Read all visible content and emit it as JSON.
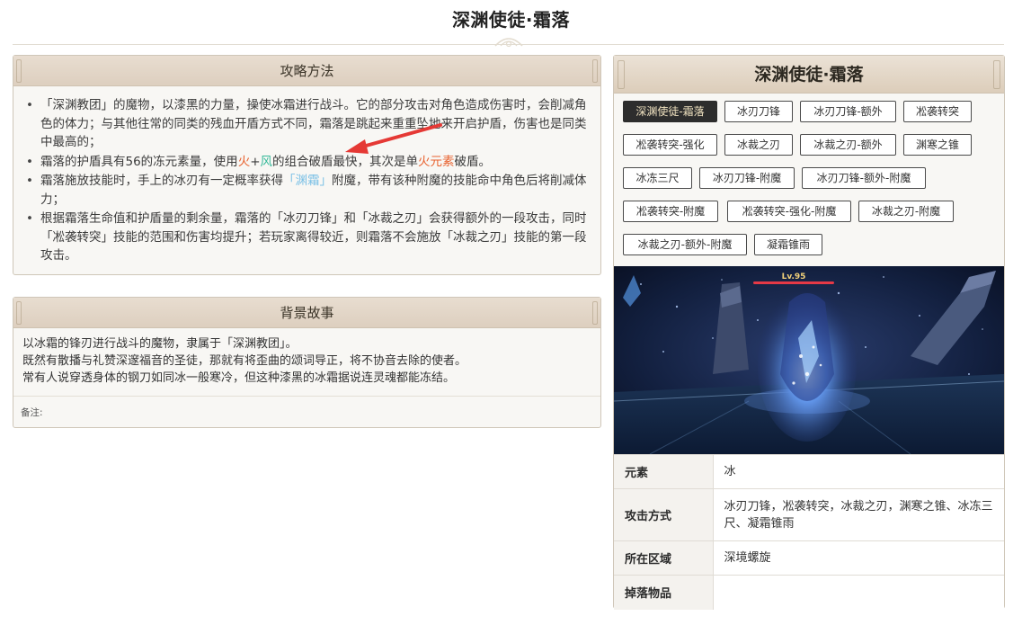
{
  "page": {
    "title": "深渊使徒·霜落"
  },
  "strategy": {
    "heading": "攻略方法",
    "items": [
      {
        "text": "「深渊教团」的魔物，以漆黑的力量，操使冰霜进行战斗。它的部分攻击对角色造成伤害时，会削减角色的体力；与其他往常的同类的残血开盾方式不同，霜落是跳起来重重坠地来开启护盾，伤害也是同类中最高的；"
      },
      {
        "pre": "霜落的护盾具有56的冻元素量，使用",
        "fire": "火",
        "plus": "+",
        "wind": "风",
        "mid": "的组合破盾最快，其次是单",
        "fire_elem": "火元素",
        "post": "破盾。"
      },
      {
        "pre": "霜落施放技能时，手上的冰刃有一定概率获得",
        "abyss": "「渊霜」",
        "post": "附魔，带有该种附魔的技能命中角色后将削减体力；"
      },
      {
        "text": "根据霜落生命值和护盾量的剩余量，霜落的「冰刃刀锋」和「冰裁之刃」会获得额外的一段攻击，同时「凇袭转突」技能的范围和伤害均提升；若玩家离得较近，则霜落不会施放「冰裁之刃」技能的第一段攻击。"
      }
    ]
  },
  "lore": {
    "heading": "背景故事",
    "lines": [
      "以冰霜的锋刃进行战斗的魔物，隶属于「深渊教团」。",
      "既然有散播与礼赞深邃福音的圣徒，那就有将歪曲的颂词导正，将不协音去除的使者。",
      "常有人说穿透身体的钢刀如同冰一般寒冷，但这种漆黑的冰霜据说连灵魂都能冻结。"
    ],
    "note_label": "备注:"
  },
  "info": {
    "title": "深渊使徒·霜落",
    "tabs": [
      "深渊使徒-霜落",
      "冰刃刀锋",
      "冰刃刀锋-额外",
      "凇袭转突",
      "凇袭转突-强化",
      "冰裁之刃",
      "冰裁之刃-额外",
      "渊寒之锥",
      "冰冻三尺",
      "冰刃刀锋-附魔",
      "冰刃刀锋-额外-附魔",
      "凇袭转突-附魔",
      "凇袭转突-强化-附魔",
      "冰裁之刃-附魔",
      "冰裁之刃-额外-附魔",
      "凝霜锥雨"
    ],
    "active_tab": 0,
    "image": {
      "level_label": "Lv.95"
    },
    "attributes": [
      {
        "key": "元素",
        "value": "冰"
      },
      {
        "key": "攻击方式",
        "value": "冰刃刀锋，凇袭转突，冰裁之刃，渊寒之锥、冰冻三尺、凝霜锥雨"
      },
      {
        "key": "所在区域",
        "value": "深境螺旋"
      },
      {
        "key": "掉落物品",
        "value": ""
      }
    ]
  },
  "colors": {
    "fire": "#e8622f",
    "wind": "#35b999",
    "abyss_frost": "#7cc1e6",
    "annotation_arrow": "#e53935",
    "active_tab_bg": "#2d2d2d"
  },
  "icons": [
    "title-ornament-icon",
    "red-arrow-annotation"
  ]
}
